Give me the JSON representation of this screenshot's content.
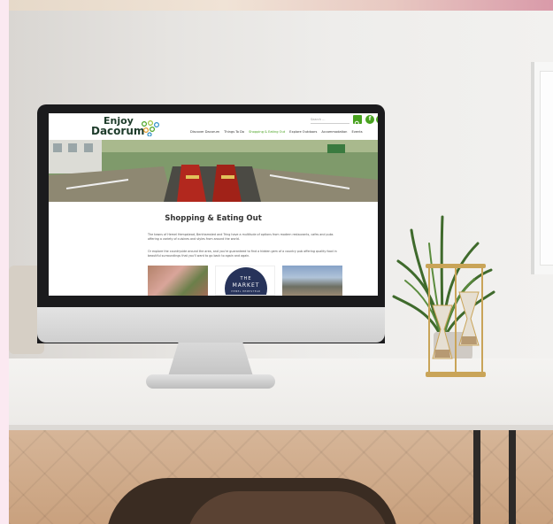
{
  "site": {
    "logo_line1": "Enjoy",
    "logo_line2": "Dacorum",
    "search_placeholder": "Search ...",
    "nav": [
      "Discover Dacorum",
      "Things To Do",
      "Shopping & Eating Out",
      "Explore Outdoors",
      "Accommodation",
      "Events"
    ],
    "active_nav_index": 2,
    "page_title": "Shopping & Eating Out",
    "paragraphs": [
      "The towns of Hemel Hempstead, Berkhamsted and Tring have a multitude of options from modern restaurants, cafes and pubs offering a variety of cuisines and styles from around the world.",
      "Or explore the countryside around the area, and you're guaranteed to find a hidden gem of a country pub offering quality food in beautiful surroundings that you'll want to go back to again and again."
    ],
    "market_badge": {
      "line1": "THE",
      "line2": "MARKET",
      "line3": "HEMEL HEMPSTEAD"
    }
  },
  "colors": {
    "brand_green": "#48a21f",
    "logo_text": "#1d3b2a",
    "market_navy": "#27335a"
  },
  "icons": {
    "search": "search-icon",
    "facebook": "facebook-icon",
    "twitter": "twitter-icon"
  }
}
